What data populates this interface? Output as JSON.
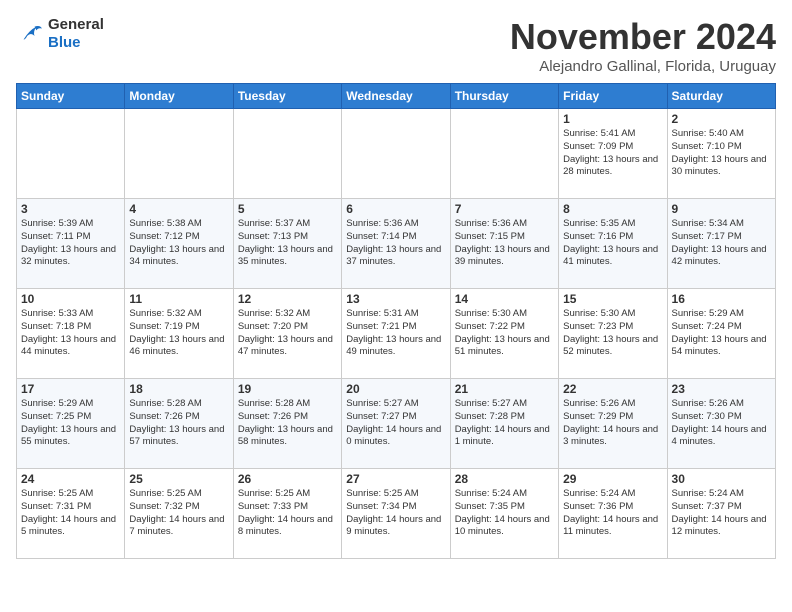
{
  "logo": {
    "general": "General",
    "blue": "Blue"
  },
  "header": {
    "month": "November 2024",
    "location": "Alejandro Gallinal, Florida, Uruguay"
  },
  "weekdays": [
    "Sunday",
    "Monday",
    "Tuesday",
    "Wednesday",
    "Thursday",
    "Friday",
    "Saturday"
  ],
  "weeks": [
    [
      {
        "day": "",
        "info": ""
      },
      {
        "day": "",
        "info": ""
      },
      {
        "day": "",
        "info": ""
      },
      {
        "day": "",
        "info": ""
      },
      {
        "day": "",
        "info": ""
      },
      {
        "day": "1",
        "info": "Sunrise: 5:41 AM\nSunset: 7:09 PM\nDaylight: 13 hours\nand 28 minutes."
      },
      {
        "day": "2",
        "info": "Sunrise: 5:40 AM\nSunset: 7:10 PM\nDaylight: 13 hours\nand 30 minutes."
      }
    ],
    [
      {
        "day": "3",
        "info": "Sunrise: 5:39 AM\nSunset: 7:11 PM\nDaylight: 13 hours\nand 32 minutes."
      },
      {
        "day": "4",
        "info": "Sunrise: 5:38 AM\nSunset: 7:12 PM\nDaylight: 13 hours\nand 34 minutes."
      },
      {
        "day": "5",
        "info": "Sunrise: 5:37 AM\nSunset: 7:13 PM\nDaylight: 13 hours\nand 35 minutes."
      },
      {
        "day": "6",
        "info": "Sunrise: 5:36 AM\nSunset: 7:14 PM\nDaylight: 13 hours\nand 37 minutes."
      },
      {
        "day": "7",
        "info": "Sunrise: 5:36 AM\nSunset: 7:15 PM\nDaylight: 13 hours\nand 39 minutes."
      },
      {
        "day": "8",
        "info": "Sunrise: 5:35 AM\nSunset: 7:16 PM\nDaylight: 13 hours\nand 41 minutes."
      },
      {
        "day": "9",
        "info": "Sunrise: 5:34 AM\nSunset: 7:17 PM\nDaylight: 13 hours\nand 42 minutes."
      }
    ],
    [
      {
        "day": "10",
        "info": "Sunrise: 5:33 AM\nSunset: 7:18 PM\nDaylight: 13 hours\nand 44 minutes."
      },
      {
        "day": "11",
        "info": "Sunrise: 5:32 AM\nSunset: 7:19 PM\nDaylight: 13 hours\nand 46 minutes."
      },
      {
        "day": "12",
        "info": "Sunrise: 5:32 AM\nSunset: 7:20 PM\nDaylight: 13 hours\nand 47 minutes."
      },
      {
        "day": "13",
        "info": "Sunrise: 5:31 AM\nSunset: 7:21 PM\nDaylight: 13 hours\nand 49 minutes."
      },
      {
        "day": "14",
        "info": "Sunrise: 5:30 AM\nSunset: 7:22 PM\nDaylight: 13 hours\nand 51 minutes."
      },
      {
        "day": "15",
        "info": "Sunrise: 5:30 AM\nSunset: 7:23 PM\nDaylight: 13 hours\nand 52 minutes."
      },
      {
        "day": "16",
        "info": "Sunrise: 5:29 AM\nSunset: 7:24 PM\nDaylight: 13 hours\nand 54 minutes."
      }
    ],
    [
      {
        "day": "17",
        "info": "Sunrise: 5:29 AM\nSunset: 7:25 PM\nDaylight: 13 hours\nand 55 minutes."
      },
      {
        "day": "18",
        "info": "Sunrise: 5:28 AM\nSunset: 7:26 PM\nDaylight: 13 hours\nand 57 minutes."
      },
      {
        "day": "19",
        "info": "Sunrise: 5:28 AM\nSunset: 7:26 PM\nDaylight: 13 hours\nand 58 minutes."
      },
      {
        "day": "20",
        "info": "Sunrise: 5:27 AM\nSunset: 7:27 PM\nDaylight: 14 hours\nand 0 minutes."
      },
      {
        "day": "21",
        "info": "Sunrise: 5:27 AM\nSunset: 7:28 PM\nDaylight: 14 hours\nand 1 minute."
      },
      {
        "day": "22",
        "info": "Sunrise: 5:26 AM\nSunset: 7:29 PM\nDaylight: 14 hours\nand 3 minutes."
      },
      {
        "day": "23",
        "info": "Sunrise: 5:26 AM\nSunset: 7:30 PM\nDaylight: 14 hours\nand 4 minutes."
      }
    ],
    [
      {
        "day": "24",
        "info": "Sunrise: 5:25 AM\nSunset: 7:31 PM\nDaylight: 14 hours\nand 5 minutes."
      },
      {
        "day": "25",
        "info": "Sunrise: 5:25 AM\nSunset: 7:32 PM\nDaylight: 14 hours\nand 7 minutes."
      },
      {
        "day": "26",
        "info": "Sunrise: 5:25 AM\nSunset: 7:33 PM\nDaylight: 14 hours\nand 8 minutes."
      },
      {
        "day": "27",
        "info": "Sunrise: 5:25 AM\nSunset: 7:34 PM\nDaylight: 14 hours\nand 9 minutes."
      },
      {
        "day": "28",
        "info": "Sunrise: 5:24 AM\nSunset: 7:35 PM\nDaylight: 14 hours\nand 10 minutes."
      },
      {
        "day": "29",
        "info": "Sunrise: 5:24 AM\nSunset: 7:36 PM\nDaylight: 14 hours\nand 11 minutes."
      },
      {
        "day": "30",
        "info": "Sunrise: 5:24 AM\nSunset: 7:37 PM\nDaylight: 14 hours\nand 12 minutes."
      }
    ]
  ]
}
